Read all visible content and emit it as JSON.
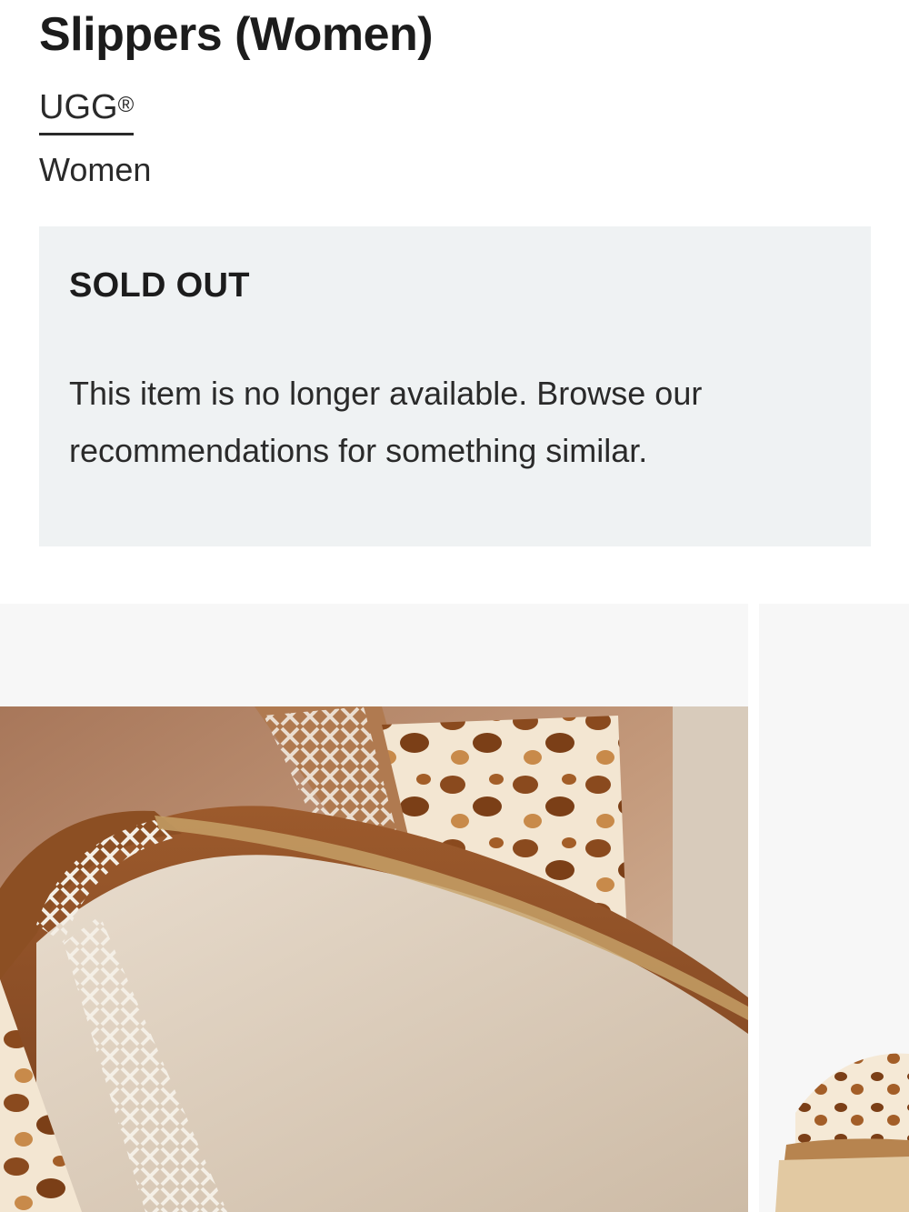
{
  "product": {
    "title": "Slippers (Women)",
    "brand": "UGG",
    "brand_mark": "®",
    "category": "Women"
  },
  "availability": {
    "status": "SOLD OUT",
    "message": "This item is no longer available. Browse our recommendations for something similar."
  },
  "recommendations": {
    "items": [
      {
        "image": "leopard-print-tasman-slipper-closeup"
      },
      {
        "image": "leopard-print-slipper-partial"
      }
    ]
  },
  "colors": {
    "panel_background": "#eff2f3",
    "text_primary": "#1c1c1c",
    "card_background": "#f7f7f7"
  }
}
